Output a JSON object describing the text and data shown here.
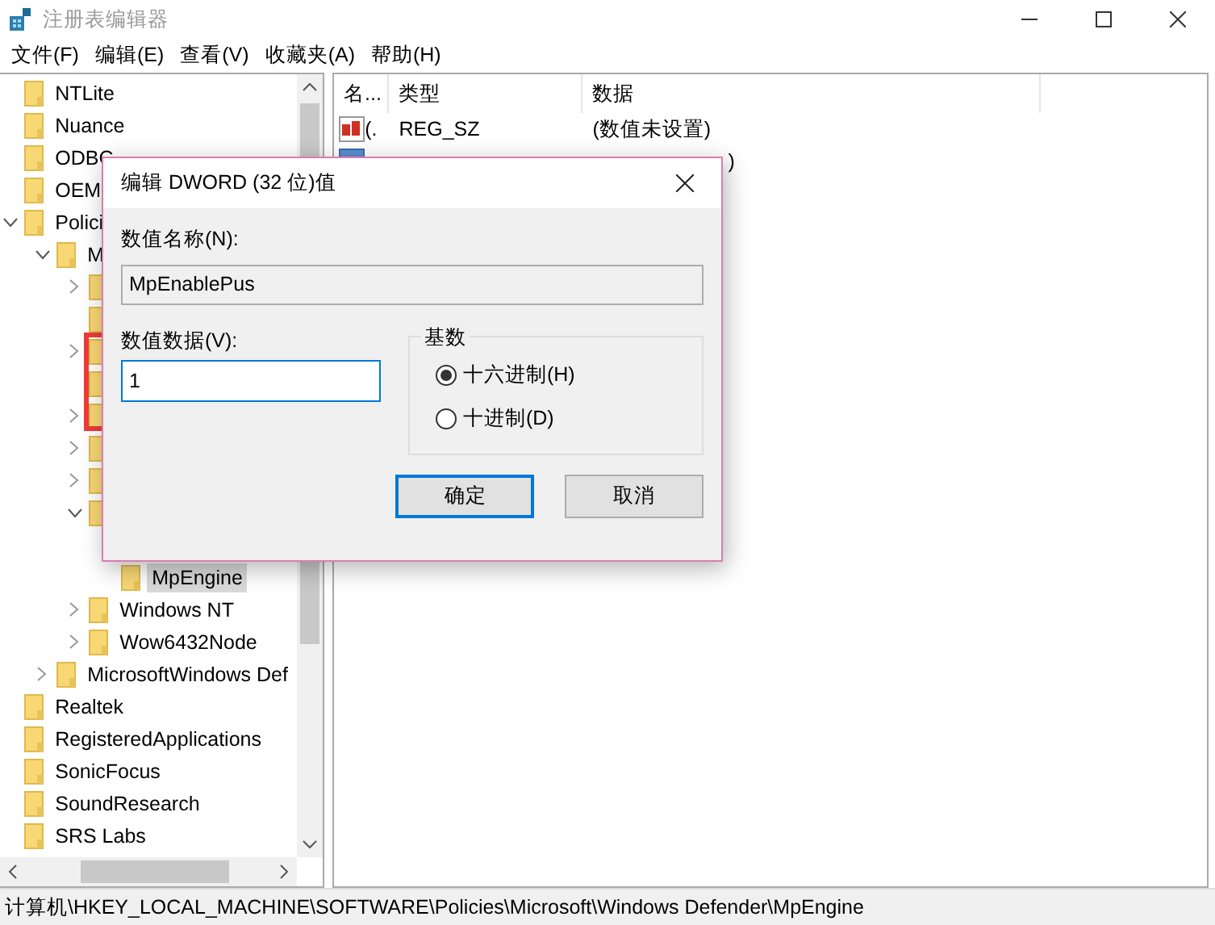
{
  "window": {
    "title": "注册表编辑器"
  },
  "menu": [
    "文件(F)",
    "编辑(E)",
    "查看(V)",
    "收藏夹(A)",
    "帮助(H)"
  ],
  "tree": [
    {
      "kind": "folder",
      "label": "NTLite"
    },
    {
      "kind": "folder",
      "label": "Nuance"
    },
    {
      "kind": "folder",
      "label": "ODBC"
    },
    {
      "kind": "folder",
      "label": "OEM"
    },
    {
      "kind": "folder",
      "label": "Polici",
      "expanded": true,
      "children": [
        {
          "kind": "folder",
          "label": "M",
          "expanded": true,
          "children": [
            {
              "kind": "folder",
              "expanded": false
            },
            {
              "kind": "folder"
            },
            {
              "kind": "folder",
              "expanded": false
            },
            {
              "kind": "folder"
            },
            {
              "kind": "folder",
              "expanded": false
            },
            {
              "kind": "folder",
              "expanded": false
            },
            {
              "kind": "folder",
              "expanded": false
            },
            {
              "kind": "folder",
              "expanded": true,
              "children": [
                {
                  "kind": "covered"
                },
                {
                  "kind": "folder",
                  "label": "MpEngine",
                  "selected": true
                }
              ]
            },
            {
              "kind": "folder",
              "label": "Windows NT",
              "expanded": false
            },
            {
              "kind": "folder",
              "label": "Wow6432Node",
              "expanded": false
            }
          ]
        },
        {
          "kind": "folder",
          "label": "MicrosoftWindows Def",
          "expanded": false
        }
      ]
    },
    {
      "kind": "folder",
      "label": "Realtek"
    },
    {
      "kind": "folder",
      "label": "RegisteredApplications"
    },
    {
      "kind": "folder",
      "label": "SonicFocus"
    },
    {
      "kind": "folder",
      "label": "SoundResearch"
    },
    {
      "kind": "folder",
      "label": "SRS Labs"
    }
  ],
  "table": {
    "columns": [
      "名...",
      "类型",
      "数据"
    ],
    "rows": [
      {
        "kind": "string",
        "name": "(.",
        "type": "REG_SZ",
        "data": "(数值未设置)"
      },
      {
        "kind": "dword",
        "data": ")"
      }
    ]
  },
  "dialog": {
    "title": "编辑 DWORD (32 位)值",
    "name_label": "数值名称(N):",
    "name_value": "MpEnablePus",
    "data_label": "数值数据(V):",
    "data_value": "1",
    "base_label": "基数",
    "bases": [
      {
        "label": "十六进制(H)",
        "selected": true
      },
      {
        "label": "十进制(D)",
        "selected": false
      }
    ],
    "buttons": [
      {
        "label": "确定",
        "default": true
      },
      {
        "label": "取消",
        "default": false
      }
    ]
  },
  "status_bar": "计算机\\HKEY_LOCAL_MACHINE\\SOFTWARE\\Policies\\Microsoft\\Windows Defender\\MpEngine"
}
